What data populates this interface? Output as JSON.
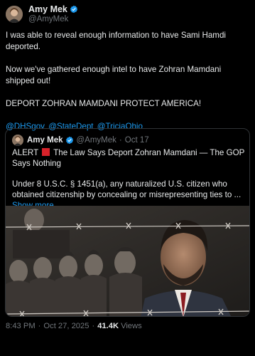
{
  "author": {
    "display_name": "Amy Mek",
    "handle": "@AmyMek",
    "verified_icon": "verified-badge-icon",
    "verified_color": "#1d9bf0"
  },
  "tweet": {
    "paragraph_1": "I was able to reveal enough information to have Sami Hamdi deported.",
    "paragraph_2": "Now we've gathered enough intel to have Zohran Mamdani shipped out!",
    "paragraph_3": "DEPORT ZOHRAN MAMDANI PROTECT AMERICA!",
    "mentions": [
      "@DHSgov",
      "@StateDept",
      "@TriciaOhio"
    ]
  },
  "quote": {
    "display_name": "Amy Mek",
    "handle": "@AmyMek",
    "separator": "·",
    "date": "Oct 17",
    "alert_prefix": "ALERT",
    "alert_icon": "red-square-icon",
    "headline": "The Law Says Deport Zohran Mamdani — The GOP Says Nothing",
    "body": "Under 8 U.S.C. § 1451(a), any naturalized U.S. citizen who obtained citizenship by concealing or misrepresenting ties to ...",
    "show_more": "Show more"
  },
  "footer": {
    "time": "8:43 PM",
    "separator": "·",
    "date": "Oct 27, 2025",
    "separator_2": "·",
    "views_count": "41.4K",
    "views_label": "Views"
  },
  "colors": {
    "background": "#000000",
    "text": "#e7e9ea",
    "muted": "#71767b",
    "link": "#1d9bf0",
    "border": "#2f3336",
    "alert_red": "#d8222a"
  }
}
